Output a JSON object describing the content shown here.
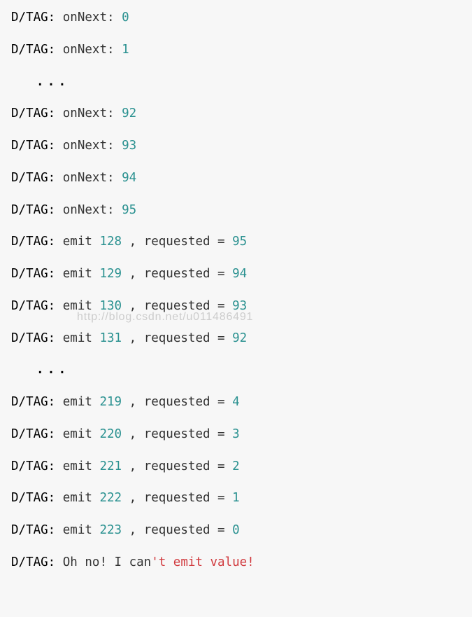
{
  "lines": [
    {
      "kind": "onnext",
      "tag": "D/TAG:",
      "label": "onNext:",
      "value": "0"
    },
    {
      "kind": "onnext",
      "tag": "D/TAG:",
      "label": "onNext:",
      "value": "1"
    },
    {
      "kind": "ellipsis",
      "text": "..."
    },
    {
      "kind": "onnext",
      "tag": "D/TAG:",
      "label": "onNext:",
      "value": "92"
    },
    {
      "kind": "onnext",
      "tag": "D/TAG:",
      "label": "onNext:",
      "value": "93"
    },
    {
      "kind": "onnext",
      "tag": "D/TAG:",
      "label": "onNext:",
      "value": "94"
    },
    {
      "kind": "onnext",
      "tag": "D/TAG:",
      "label": "onNext:",
      "value": "95"
    },
    {
      "kind": "emit",
      "tag": "D/TAG:",
      "label": "emit",
      "value": "128",
      "reqlabel": ", requested =",
      "req": "95"
    },
    {
      "kind": "emit",
      "tag": "D/TAG:",
      "label": "emit",
      "value": "129",
      "reqlabel": ", requested =",
      "req": "94"
    },
    {
      "kind": "emit",
      "tag": "D/TAG:",
      "label": "emit",
      "value": "130",
      "reqlabel": ", requested =",
      "req": "93"
    },
    {
      "kind": "emit",
      "tag": "D/TAG:",
      "label": "emit",
      "value": "131",
      "reqlabel": ", requested =",
      "req": "92"
    },
    {
      "kind": "ellipsis",
      "text": "..."
    },
    {
      "kind": "emit",
      "tag": "D/TAG:",
      "label": "emit",
      "value": "219",
      "reqlabel": ", requested =",
      "req": "4"
    },
    {
      "kind": "emit",
      "tag": "D/TAG:",
      "label": "emit",
      "value": "220",
      "reqlabel": ", requested =",
      "req": "3"
    },
    {
      "kind": "emit",
      "tag": "D/TAG:",
      "label": "emit",
      "value": "221",
      "reqlabel": ", requested =",
      "req": "2"
    },
    {
      "kind": "emit",
      "tag": "D/TAG:",
      "label": "emit",
      "value": "222",
      "reqlabel": ", requested =",
      "req": "1"
    },
    {
      "kind": "emit",
      "tag": "D/TAG:",
      "label": "emit",
      "value": "223",
      "reqlabel": ", requested =",
      "req": "0"
    },
    {
      "kind": "error",
      "tag": "D/TAG:",
      "prefix": "Oh no! I can",
      "suffix": "'t emit value!"
    }
  ],
  "watermark": "http://blog.csdn.net/u011486491"
}
